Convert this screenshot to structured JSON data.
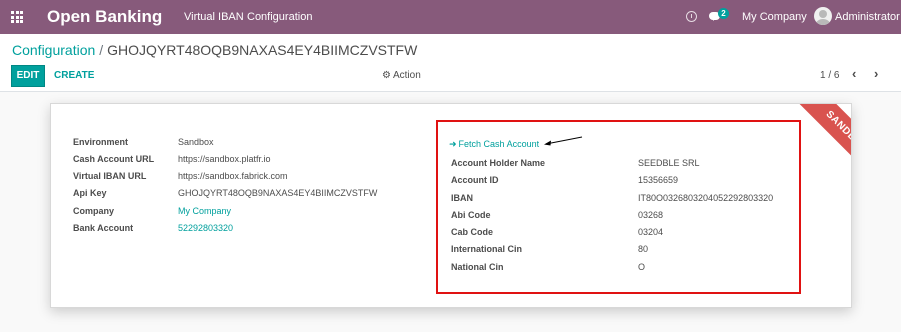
{
  "navbar": {
    "app_title": "Open Banking",
    "menu": [
      "Virtual IBAN",
      "Configuration"
    ],
    "chat_count": "2",
    "company": "My Company",
    "user": "Administrator"
  },
  "control_panel": {
    "breadcrumb_parent": "Configuration",
    "breadcrumb_separator": "/",
    "breadcrumb_current": "GHOJQYRT48OQB9NAXAS4EY4BIIMCZVSTFW",
    "edit_label": "EDIT",
    "create_label": "CREATE",
    "action_label": "Action",
    "pager": "1 / 6"
  },
  "ribbon": "SANDBOX",
  "left_fields": [
    {
      "label": "Environment",
      "value": "Sandbox"
    },
    {
      "label": "Cash Account URL",
      "value": "https://sandbox.platfr.io"
    },
    {
      "label": "Virtual IBAN URL",
      "value": "https://sandbox.fabrick.com"
    },
    {
      "label": "Api Key",
      "value": "GHOJQYRT48OQB9NAXAS4EY4BIIMCZVSTFW"
    },
    {
      "label": "Company",
      "value": "My Company"
    },
    {
      "label": "Bank Account",
      "value": "52292803320"
    }
  ],
  "fetch_button_label": "Fetch Cash Account",
  "right_fields": [
    {
      "label": "Account Holder Name",
      "value": "SEEDBLE SRL"
    },
    {
      "label": "Account ID",
      "value": "15356659"
    },
    {
      "label": "IBAN",
      "value": "IT80O0326803204052292803320"
    },
    {
      "label": "Abi Code",
      "value": "03268"
    },
    {
      "label": "Cab Code",
      "value": "03204"
    },
    {
      "label": "International Cin",
      "value": "80"
    },
    {
      "label": "National Cin",
      "value": "O"
    }
  ],
  "colors": {
    "navbar": "#875a7b",
    "accent": "#00a09d",
    "ribbon": "#d9534f",
    "highlight": "#e01212"
  }
}
